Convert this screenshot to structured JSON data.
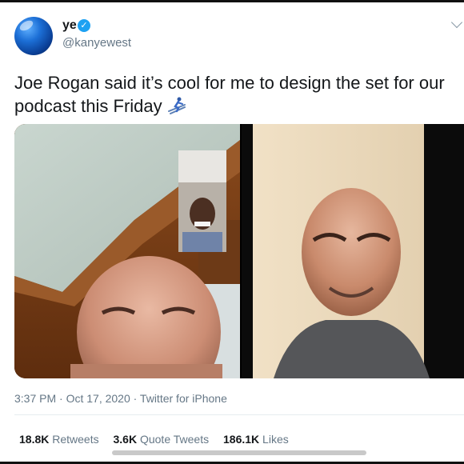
{
  "author": {
    "display_name": "ye",
    "handle": "@kanyewest",
    "avatar_icon": "blue-globe-avatar",
    "verified_icon": "verified-badge-icon",
    "verified_color": "#1da1f2"
  },
  "tweet": {
    "text": "Joe Rogan said it’s cool for me to design the set for our podcast this Friday",
    "emoji_icon": "skier-emoji"
  },
  "media": {
    "left_image": "video-call-screenshot",
    "right_image": "portrait-photo"
  },
  "meta": {
    "timestamp": "3:37 PM · Oct 17, 2020 · Twitter for iPhone"
  },
  "stats": {
    "retweets_count": "18.8K",
    "retweets_label": "Retweets",
    "quote_count": "3.6K",
    "quote_label": "Quote Tweets",
    "likes_count": "186.1K",
    "likes_label": "Likes"
  },
  "colors": {
    "text_primary": "#14171a",
    "text_secondary": "#657786",
    "divider": "#e6ecf0"
  }
}
